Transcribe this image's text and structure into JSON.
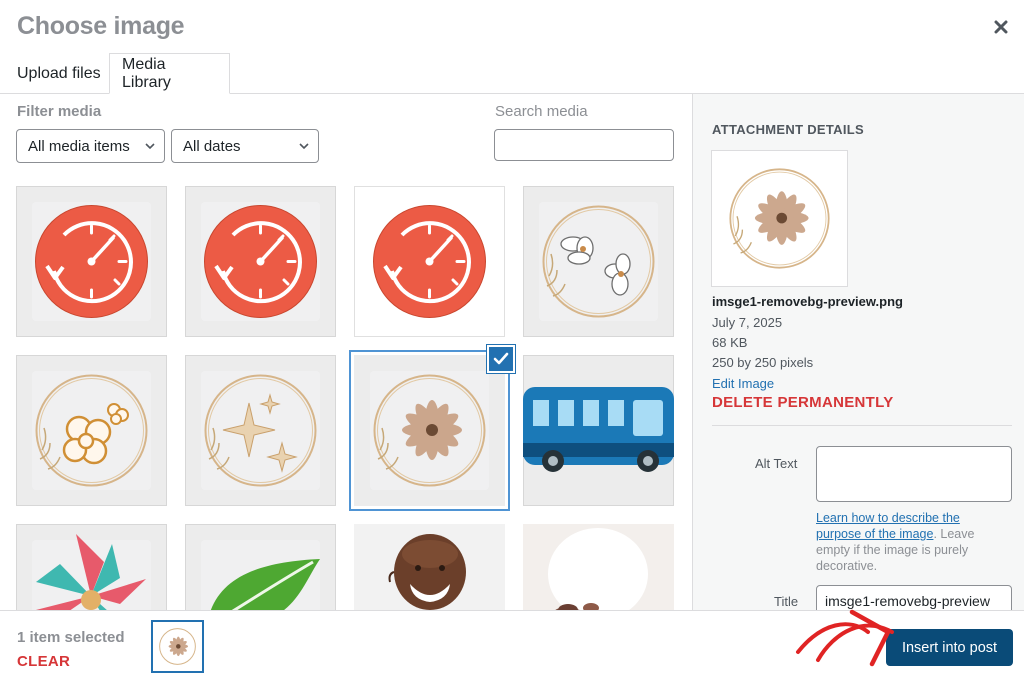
{
  "header": {
    "title": "Choose image",
    "close_icon": "close-icon"
  },
  "tabs": [
    {
      "label": "Upload files",
      "active": false
    },
    {
      "label": "Media Library",
      "active": true
    }
  ],
  "toolbar": {
    "filter_label": "Filter media",
    "type_filter_value": "All media items",
    "date_filter_value": "All dates",
    "search_label": "Search media",
    "search_value": ""
  },
  "grid": {
    "items": [
      {
        "name": "clock-red-icon",
        "selected": false
      },
      {
        "name": "clock-red-icon",
        "selected": false
      },
      {
        "name": "clock-red-icon",
        "selected": false
      },
      {
        "name": "white-flowers-wreath",
        "selected": false
      },
      {
        "name": "hibiscus-wreath",
        "selected": false
      },
      {
        "name": "sparkles-wreath",
        "selected": false
      },
      {
        "name": "brown-flower-wreath",
        "selected": true
      },
      {
        "name": "blue-bus",
        "selected": false
      },
      {
        "name": "colorful-pinwheel",
        "selected": false
      },
      {
        "name": "green-leaf",
        "selected": false
      },
      {
        "name": "smiling-man-photo",
        "selected": false
      },
      {
        "name": "photo-partial",
        "selected": false
      }
    ]
  },
  "attachment": {
    "heading": "ATTACHMENT DETAILS",
    "filename": "imsge1-removebg-preview.png",
    "date": "July 7, 2025",
    "filesize": "68 KB",
    "dimensions": "250 by 250 pixels",
    "edit_label": "Edit Image",
    "delete_label": "DELETE PERMANENTLY",
    "alt_text_label": "Alt Text",
    "alt_text_value": "",
    "alt_help_link": "Learn how to describe the purpose of the image",
    "alt_help_rest": ". Leave empty if the image is purely decorative.",
    "title_label": "Title",
    "title_value": "imsge1-removebg-preview"
  },
  "footer": {
    "selected_count": "1 item selected",
    "clear_label": "CLEAR",
    "insert_label": "Insert into post"
  },
  "colors": {
    "accent": "#2271b1",
    "primary_button": "#0a4b78",
    "danger": "#d63638",
    "annotation_arrow": "#e02424",
    "clock_red": "#ec5b45",
    "bus_blue": "#1b79b7",
    "leaf_green": "#4ea832",
    "flower_brown": "#b98e72",
    "wreath_gold": "#d6b58a"
  }
}
